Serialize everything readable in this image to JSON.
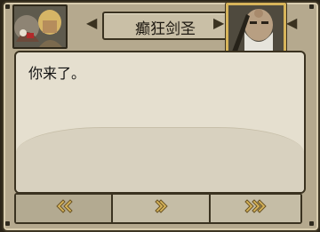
{
  "header": {
    "speaker_name": "癫狂剑圣",
    "prev_icon": "triangle-left-icon",
    "next_icon": "triangle-right-icon"
  },
  "dialog": {
    "text": "你来了。"
  },
  "controls": {
    "back_icon": "double-chevron-left-icon",
    "next_icon": "chevron-right-icon",
    "skip_icon": "double-chevron-right-icon"
  },
  "colors": {
    "frame": "#b5a98e",
    "accent_gold": "#d7b45a",
    "panel": "#e5dfcf"
  }
}
